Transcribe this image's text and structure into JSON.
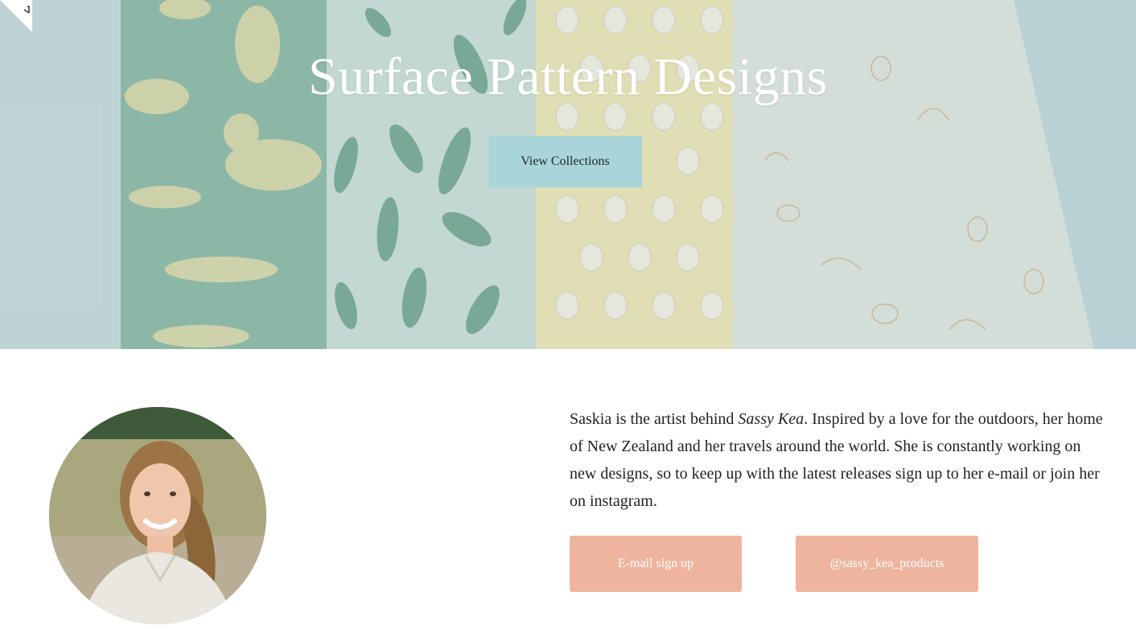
{
  "hero": {
    "title": "Surface Pattern Designs",
    "cta_label": "View Collections"
  },
  "about": {
    "bio_pre": "Saskia is the artist behind ",
    "bio_brand": "Sassy Kea",
    "bio_post": ". Inspired by a love for the outdoors, her home of New Zealand and her travels around the world. She is constantly working on new designs, so to keep up with the latest releases sign up to her e-mail or join her on instagram.",
    "email_label": "E-mail sign up",
    "instagram_label": "@sassy_kea_products"
  },
  "colors": {
    "cta_button": "#a9d5d9",
    "action_buttons": "#efb49d",
    "hero_bg": "#c9dfe0"
  },
  "icons": [
    "expand-corner-icon"
  ]
}
